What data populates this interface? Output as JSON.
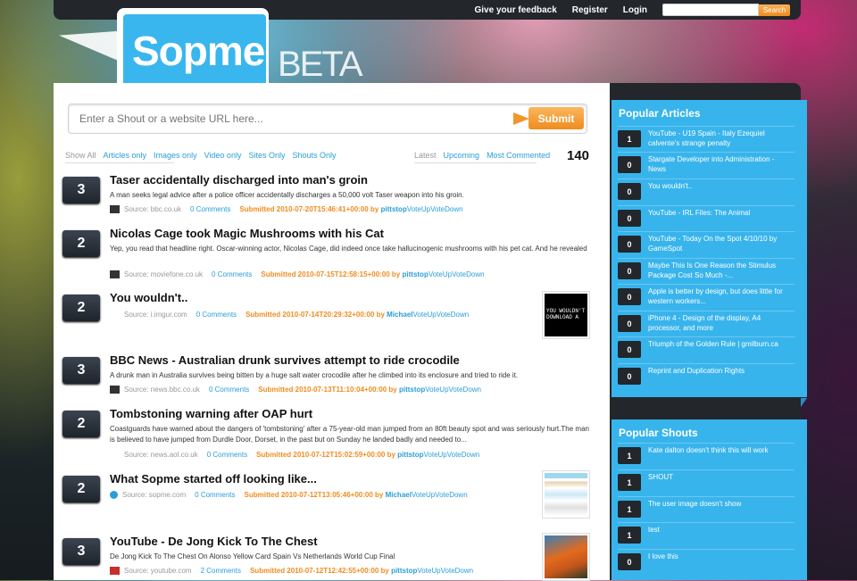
{
  "header": {
    "links": [
      "Give your feedback",
      "Register",
      "Login"
    ],
    "search_button": "Search",
    "logo": "Sopme",
    "beta": "BETA"
  },
  "shout": {
    "placeholder": "Enter a Shout or a website URL here...",
    "submit": "Submit"
  },
  "filters": [
    "Show All",
    "Articles only",
    "Images only",
    "Video only",
    "Sites Only",
    "Shouts Only"
  ],
  "sorts": [
    "Latest",
    "Upcoming",
    "Most Commented"
  ],
  "count": "140",
  "items": [
    {
      "votes": "3",
      "title": "Taser accidentally discharged into man's groin",
      "desc": "A man seeks legal advice after a police officer accidentally discharges a 50,000 volt Taser weapon into his groin.",
      "source": "Source: bbc.co.uk",
      "comments": "0 Comments",
      "submitted": "Submitted 2010-07-20T15:46:41+00:00 by",
      "user": "pittstop",
      "vote": "VoteUpVoteDown"
    },
    {
      "votes": "2",
      "title": "Nicolas Cage took Magic Mushrooms with his Cat",
      "desc": "Yep, you read that headline right. Oscar-winning actor, Nicolas Cage, did indeed once take hallucinogenic mushrooms with his pet cat. And he revealed",
      "source": "Source: moviefone.co.uk",
      "comments": "0 Comments",
      "submitted": "Submitted 2010-07-15T12:58:15+00:00 by",
      "user": "pittstop",
      "vote": "VoteUpVoteDown"
    },
    {
      "votes": "2",
      "title": "You wouldn't..",
      "desc": "",
      "source": "Source: i.imgur.com",
      "comments": "0 Comments",
      "submitted": "Submitted 2010-07-14T20:29:32+00:00 by",
      "user": "Michael",
      "vote": "VoteUpVoteDown",
      "thumb_text": "YOU WOULDN'T DOWNLOAD A"
    },
    {
      "votes": "3",
      "title": "BBC News - Australian drunk survives attempt to ride crocodile",
      "desc": "A drunk man in Australia survives being bitten by a huge salt water crocodile after he climbed into its enclosure and tried to ride it.",
      "source": "Source: news.bbc.co.uk",
      "comments": "0 Comments",
      "submitted": "Submitted 2010-07-13T11:10:04+00:00 by",
      "user": "pittstop",
      "vote": "VoteUpVoteDown"
    },
    {
      "votes": "2",
      "title": "Tombstoning warning after OAP hurt",
      "desc": "Coastguards have warned about the dangers of 'tombstoning' after a 75-year-old man jumped from an 80ft beauty spot and was seriously hurt.The man is believed to have jumped from Durdle Door, Dorset, in the past but on Sunday he landed badly and needed to...",
      "source": "Source: news.aol.co.uk",
      "comments": "0 Comments",
      "submitted": "Submitted 2010-07-12T15:02:59+00:00 by",
      "user": "pittstop",
      "vote": "VoteUpVoteDown"
    },
    {
      "votes": "2",
      "title": "What Sopme started off looking like...",
      "desc": "",
      "source": "Source: sopme.com",
      "comments": "0 Comments",
      "submitted": "Submitted 2010-07-12T13:05:46+00:00 by",
      "user": "Michael",
      "vote": "VoteUpVoteDown"
    },
    {
      "votes": "3",
      "title": "YouTube - De Jong Kick To The Chest",
      "desc": "De Jong Kick To The Chest On Alonso Yellow Card Spain Vs Netherlands World Cup Final",
      "source": "Source: youtube.com",
      "comments": "2 Comments",
      "submitted": "Submitted 2010-07-12T12:42:55+00:00 by",
      "user": "pittstop",
      "vote": "VoteUpVoteDown"
    }
  ],
  "popular_articles": {
    "title": "Popular Articles",
    "items": [
      {
        "num": "1",
        "text": "YouTube - U19 Spain - Italy Ezequiel calvente's strange penalty"
      },
      {
        "num": "0",
        "text": "Stargate Developer into Administration - News"
      },
      {
        "num": "0",
        "text": "You wouldn't.."
      },
      {
        "num": "0",
        "text": "YouTube - IRL Files: The Animal"
      },
      {
        "num": "0",
        "text": "YouTube - Today On the Spot 4/10/10 by GameSpot"
      },
      {
        "num": "0",
        "text": "Maybe This Is One Reason the Stimulus Package Cost So Much -..."
      },
      {
        "num": "0",
        "text": "Apple is better by design, but does little for western workers..."
      },
      {
        "num": "0",
        "text": "iPhone 4 - Design of the display, A4 processor, and more"
      },
      {
        "num": "0",
        "text": "Triumph of the Golden Rule | gmilburn.ca"
      },
      {
        "num": "0",
        "text": "Reprint and Duplication Rights"
      }
    ]
  },
  "popular_shouts": {
    "title": "Popular Shouts",
    "items": [
      {
        "num": "1",
        "text": "Kate dalton doesn't think this will work"
      },
      {
        "num": "1",
        "text": "SHOUT"
      },
      {
        "num": "1",
        "text": "The user image doesn't show"
      },
      {
        "num": "1",
        "text": "test"
      },
      {
        "num": "0",
        "text": "I love this"
      }
    ]
  },
  "colors": {
    "accent": "#38b4ec",
    "orange": "#f08c1e",
    "dark": "#23262b",
    "link": "#2a9fd6"
  }
}
